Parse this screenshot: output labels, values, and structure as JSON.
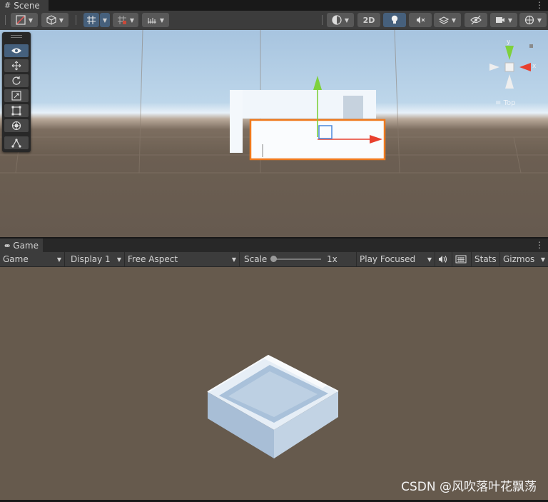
{
  "scene_tab": {
    "title": "Scene"
  },
  "scene_toolbar": {
    "mode_2d_label": "2D"
  },
  "scene_view": {
    "gizmo": {
      "y_label": "y",
      "x_label": "x",
      "view_label": "Top"
    }
  },
  "tools": [
    "view-tool",
    "move-tool",
    "rotate-tool",
    "scale-tool",
    "rect-tool",
    "transform-tool",
    "custom-tool"
  ],
  "game_tab": {
    "title": "Game"
  },
  "game_toolbar": {
    "view_dropdown": "Game",
    "display_dropdown": "Display 1",
    "aspect_dropdown": "Free Aspect",
    "scale_label": "Scale",
    "scale_value": "1x",
    "play_mode_dropdown": "Play Focused",
    "stats_label": "Stats",
    "gizmos_label": "Gizmos"
  },
  "watermark": "CSDN @风吹落叶花飘荡",
  "colors": {
    "accent_selected": "#46607c",
    "selection_outline": "#f07a1e",
    "axis_x": "#e8402e",
    "axis_y": "#7ed13c"
  }
}
